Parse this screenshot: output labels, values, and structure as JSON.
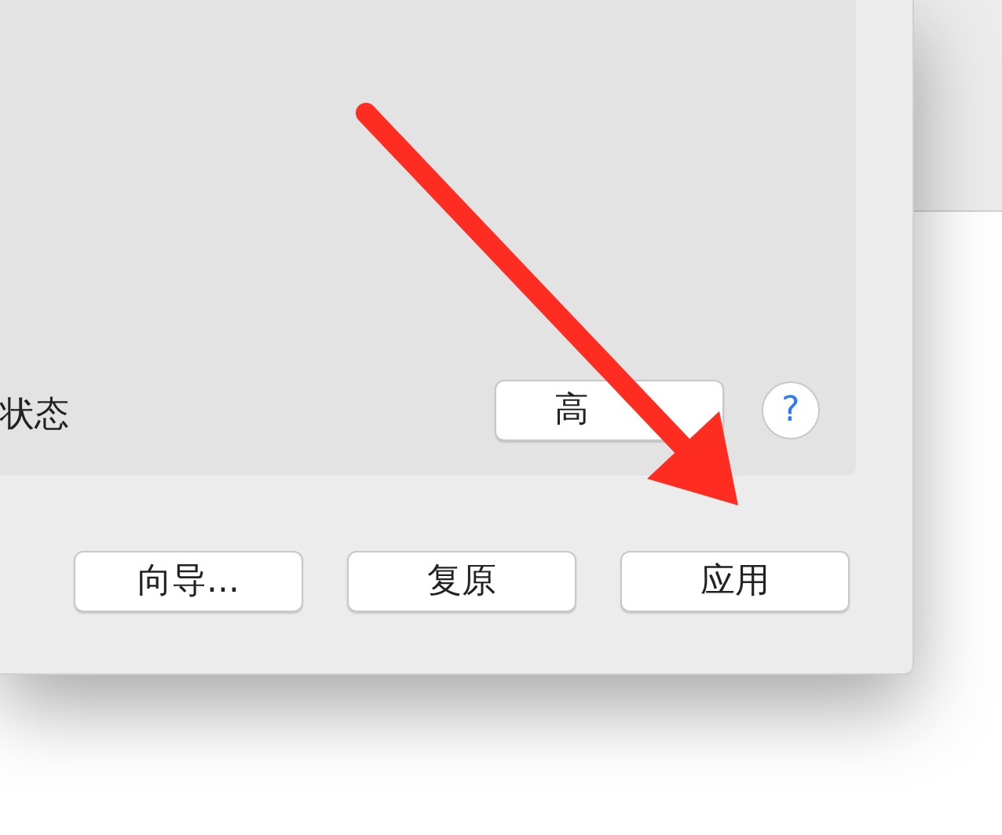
{
  "panel": {
    "status_label": "状态",
    "advanced_button": "高",
    "help_button": "?"
  },
  "buttons": [
    {
      "label": "向导..."
    },
    {
      "label": "复原"
    },
    {
      "label": "应用"
    }
  ],
  "annotation": {
    "kind": "arrow"
  }
}
